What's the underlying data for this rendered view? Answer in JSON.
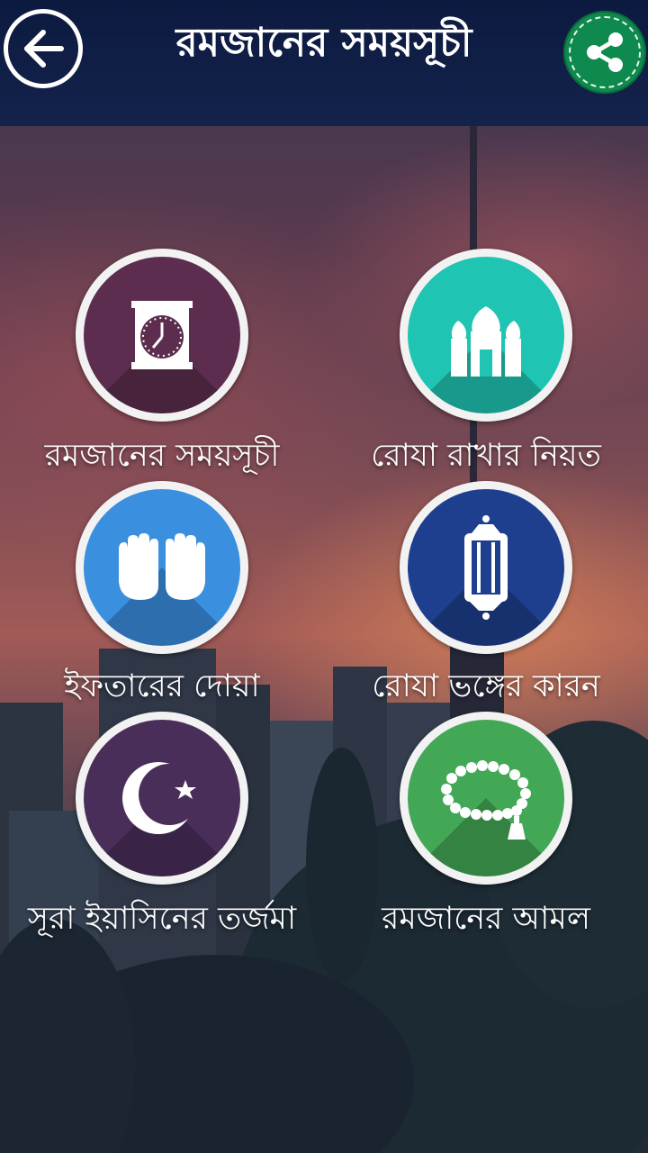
{
  "header": {
    "title": "রমজানের সময়সূচী"
  },
  "menu": [
    {
      "label": "রমজানের সময়সূচী",
      "icon": "clock-icon",
      "color": "#5c2d4e"
    },
    {
      "label": "রোযা রাখার নিয়ত",
      "icon": "mosque-icon",
      "color": "#1fc4b3"
    },
    {
      "label": "ইফতারের দোয়া",
      "icon": "praying-hands-icon",
      "color": "#3a8fdf"
    },
    {
      "label": "রোযা ভঙ্গের কারন",
      "icon": "lantern-icon",
      "color": "#1e3f8e"
    },
    {
      "label": "সূরা ইয়াসিনের তর্জমা",
      "icon": "crescent-star-icon",
      "color": "#4a2e5a"
    },
    {
      "label": "রমজানের আমল",
      "icon": "prayer-beads-icon",
      "color": "#43a856"
    }
  ]
}
